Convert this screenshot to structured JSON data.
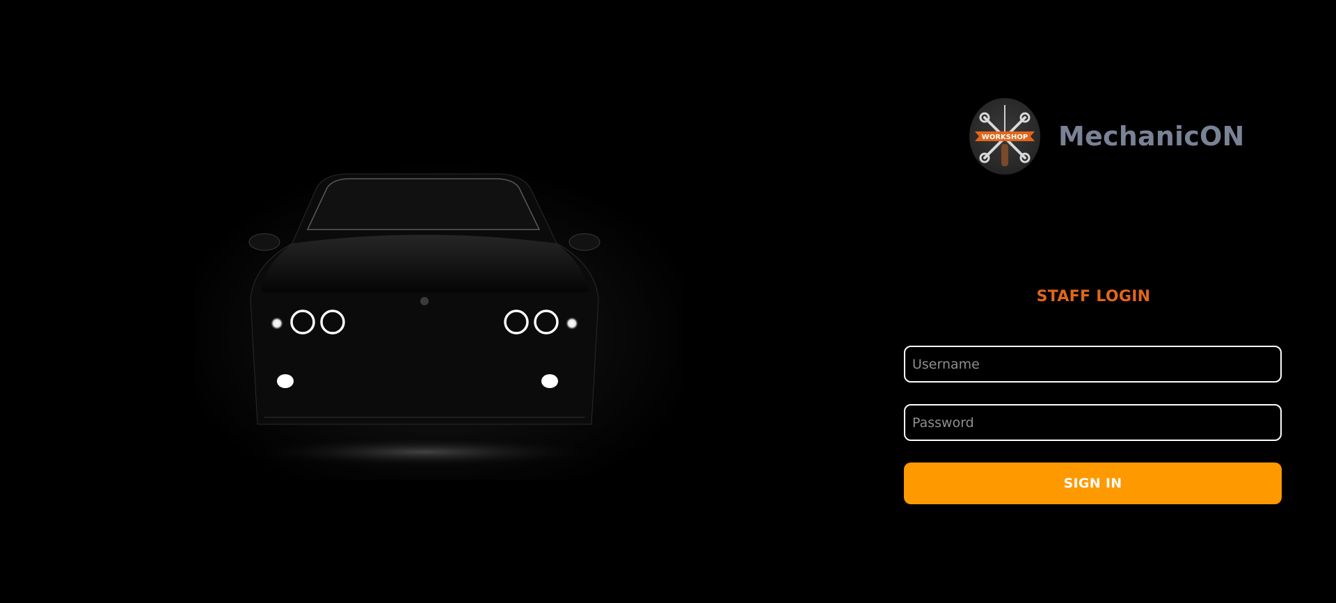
{
  "brand": {
    "name": "MechanicON",
    "logo_text": "WORKSHOP",
    "logo_icon": "workshop-logo"
  },
  "login": {
    "title": "STAFF LOGIN",
    "username_placeholder": "Username",
    "password_placeholder": "Password",
    "signin_label": "SIGN IN"
  },
  "hero": {
    "icon": "car-silhouette-image"
  },
  "colors": {
    "background": "#000000",
    "accent": "#ff9900",
    "title": "#e2661a",
    "brand_text": "#7a8295",
    "field_border": "#ffffff"
  }
}
